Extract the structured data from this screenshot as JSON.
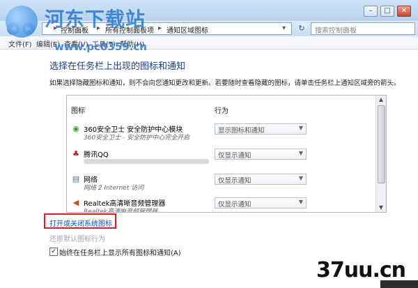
{
  "watermark": {
    "site_name": "河东下载站",
    "url": "www.pc0359.cn",
    "bottom_mark": "37uu.cn"
  },
  "address": {
    "back_icon": "back-arrow-icon",
    "forward_icon": "forward-arrow-icon",
    "crumbs": [
      "控制面板",
      "所有控制面板项",
      "通知区域图标"
    ],
    "search_placeholder": "搜索控制面板"
  },
  "menu": [
    "文件(F)",
    "编辑(E)",
    "查看(V)",
    "工具(T)",
    "帮助(H)"
  ],
  "page": {
    "title": "选择在任务栏上出现的图标和通知",
    "description": "如果选择隐藏图标和通知，则不会向您通知更改和更新。若要随时查看隐藏的图标，请单击任务栏上通知区域旁的箭头。"
  },
  "table": {
    "headers": {
      "icon": "图标",
      "behavior": "行为"
    },
    "rows": [
      {
        "name": "360安全卫士 安全防护中心模块",
        "sub": "360安全卫士 - 安全防护中心完全开启",
        "behavior": "显示图标和通知",
        "icon": "shield-icon",
        "color": "#3a9a2a"
      },
      {
        "name": "腾讯QQ",
        "sub": "",
        "behavior": "仅显示通知",
        "icon": "qq-penguin-icon",
        "color": "#c21d1d"
      },
      {
        "name": "网络",
        "sub": "网络 2 Internet 访问",
        "behavior": "仅显示通知",
        "icon": "network-icon",
        "color": "#4a6fa5"
      },
      {
        "name": "Realtek高清晰音频管理器",
        "sub": "Realtek高清晰音频管理器",
        "behavior": "仅显示通知",
        "icon": "speaker-icon",
        "color": "#c84a16"
      }
    ]
  },
  "links": {
    "open_close_system_icons": "打开或关闭系统图标",
    "restore_defaults": "还原默认图标行为"
  },
  "checkbox": {
    "label": "始终在任务栏上显示所有图标和通知(A)",
    "checked": true
  }
}
